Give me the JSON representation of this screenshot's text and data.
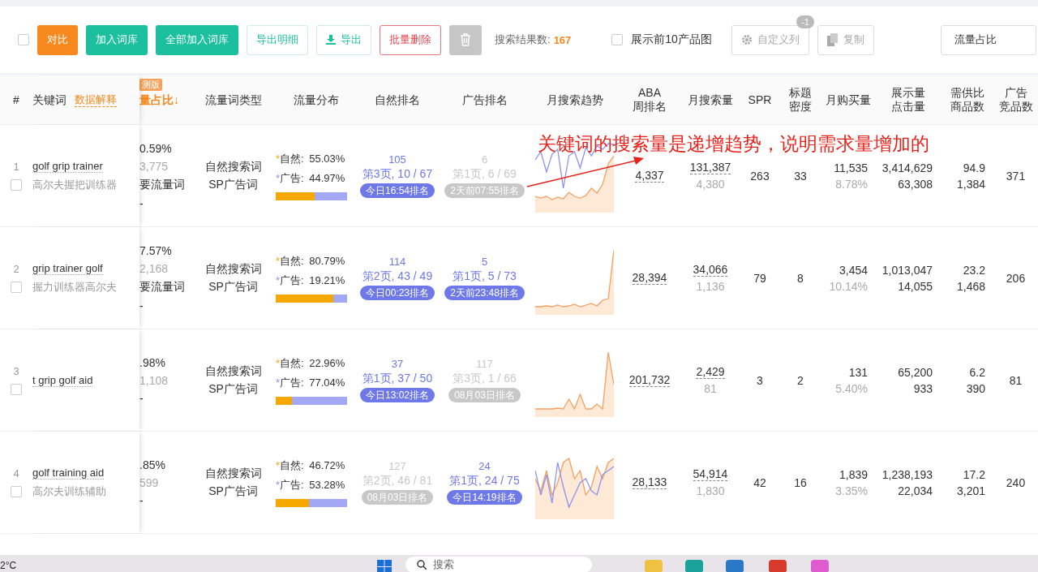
{
  "toolbar": {
    "checked": false,
    "buttons": [
      {
        "label": "对比",
        "kind": "orange"
      },
      {
        "label": "加入词库",
        "kind": "teal"
      },
      {
        "label": "全部加入词库",
        "kind": "teal"
      },
      {
        "label": "导出明细",
        "kind": "outline"
      },
      {
        "label": "导出",
        "kind": "download"
      },
      {
        "label": "批量删除",
        "kind": "danger"
      },
      {
        "kind": "trash"
      }
    ],
    "result_label": "搜索结果数:",
    "result_count": "167",
    "show_images": {
      "label": "展示前10产品图",
      "checked": false
    },
    "custom_columns": {
      "label": "自定义列",
      "badge": "-1"
    },
    "copy": {
      "label": "复制"
    },
    "sort_select": {
      "value": "流量占比"
    }
  },
  "table": {
    "columns": [
      {
        "lines": [
          "#"
        ]
      },
      {
        "lines": [
          "关键词"
        ],
        "help": "数据解释"
      },
      {
        "lines": [
          "量占比↓"
        ],
        "badge": "测版"
      },
      {
        "lines": [
          "流量词类型"
        ]
      },
      {
        "lines": [
          "流量分布"
        ]
      },
      {
        "lines": [
          "自然排名"
        ]
      },
      {
        "lines": [
          "广告排名"
        ]
      },
      {
        "lines": [
          "月搜索趋势"
        ]
      },
      {
        "lines": [
          "ABA",
          "周排名"
        ]
      },
      {
        "lines": [
          "月搜索量"
        ]
      },
      {
        "lines": [
          "SPR"
        ]
      },
      {
        "lines": [
          "标题",
          "密度"
        ]
      },
      {
        "lines": [
          "月购买量"
        ]
      },
      {
        "lines": [
          "展示量",
          "点击量"
        ]
      },
      {
        "lines": [
          "需供比",
          "商品数"
        ]
      },
      {
        "lines": [
          "广告",
          "竞品数"
        ]
      }
    ],
    "rows": [
      {
        "index": "1",
        "checked": false,
        "keyword": "golf grip trainer",
        "translation": "高尔夫握把训练器",
        "share": [
          "0.59%",
          "3,775",
          "要流量词",
          "-"
        ],
        "types": [
          "自然搜索词",
          "SP广告词"
        ],
        "distribution": {
          "natural_mark": "*",
          "natural_label": "自然:",
          "natural_value": "55.03%",
          "ad_mark": "*",
          "ad_label": "广告:",
          "ad_value": "44.97%",
          "level": 0.5503
        },
        "natural_rank": {
          "number": "105",
          "page": "第3页, 10 / 67",
          "time": "今日16:54排名",
          "active": true
        },
        "ad_rank": {
          "number": "6",
          "page": "第1页, 6 / 69",
          "time": "2天前07:55排名",
          "active": false
        },
        "aba": "4,337",
        "search": [
          "131,387",
          "4,380"
        ],
        "spr": "263",
        "title_density": "33",
        "purchase": [
          "11,535",
          "8.78%"
        ],
        "impressions": [
          "3,414,629",
          "63,308"
        ],
        "supply": [
          "94.9",
          "1,384"
        ],
        "ad_competitors": "371"
      },
      {
        "index": "2",
        "checked": false,
        "keyword": "grip trainer golf",
        "translation": "握力训练器高尔夫",
        "share": [
          "7.57%",
          "2,168",
          "要流量词",
          "-"
        ],
        "types": [
          "自然搜索词",
          "SP广告词"
        ],
        "distribution": {
          "natural_mark": "*",
          "natural_label": "自然:",
          "natural_value": "80.79%",
          "ad_mark": "*",
          "ad_label": "广告:",
          "ad_value": "19.21%",
          "level": 0.8079
        },
        "natural_rank": {
          "number": "114",
          "page": "第2页, 43 / 49",
          "time": "今日00:23排名",
          "active": true
        },
        "ad_rank": {
          "number": "5",
          "page": "第1页, 5 / 73",
          "time": "2天前23:48排名",
          "active": true
        },
        "aba": "28,394",
        "search": [
          "34,066",
          "1,136"
        ],
        "spr": "79",
        "title_density": "8",
        "purchase": [
          "3,454",
          "10.14%"
        ],
        "impressions": [
          "1,013,047",
          "14,055"
        ],
        "supply": [
          "23.2",
          "1,468"
        ],
        "ad_competitors": "206"
      },
      {
        "index": "3",
        "checked": false,
        "keyword": "t grip golf aid",
        "share": [
          ".98%",
          "1,108",
          "-"
        ],
        "types": [
          "自然搜索词",
          "SP广告词"
        ],
        "distribution": {
          "natural_mark": "*",
          "natural_label": "自然:",
          "natural_value": "22.96%",
          "ad_mark": "*",
          "ad_label": "广告:",
          "ad_value": "77.04%",
          "level": 0.2296
        },
        "natural_rank": {
          "number": "37",
          "page": "第1页, 37 / 50",
          "time": "今日13:02排名",
          "active": true
        },
        "ad_rank": {
          "number": "117",
          "page": "第3页, 1 / 66",
          "time": "08月03日排名",
          "active": false
        },
        "aba": "201,732",
        "search": [
          "2,429",
          "81"
        ],
        "spr": "3",
        "title_density": "2",
        "purchase": [
          "131",
          "5.40%"
        ],
        "impressions": [
          "65,200",
          "933"
        ],
        "supply": [
          "6.2",
          "390"
        ],
        "ad_competitors": "81"
      },
      {
        "index": "4",
        "checked": false,
        "keyword": "golf training aid",
        "translation": "高尔夫训练辅助",
        "share": [
          ".85%",
          "599",
          "-"
        ],
        "types": [
          "自然搜索词",
          "SP广告词"
        ],
        "distribution": {
          "natural_mark": "*",
          "natural_label": "自然:",
          "natural_value": "46.72%",
          "ad_mark": "*",
          "ad_label": "广告:",
          "ad_value": "53.28%",
          "level": 0.4672
        },
        "natural_rank": {
          "number": "127",
          "page": "第2页, 46 / 81",
          "time": "08月03日排名",
          "active": false
        },
        "ad_rank": {
          "number": "24",
          "page": "第1页, 24 / 75",
          "time": "今日14:19排名",
          "active": true
        },
        "aba": "28,133",
        "search": [
          "54,914",
          "1,830"
        ],
        "spr": "42",
        "title_density": "16",
        "purchase": [
          "1,839",
          "3.35%"
        ],
        "impressions": [
          "1,238,193",
          "22,034"
        ],
        "supply": [
          "17.2",
          "3,201"
        ],
        "ad_competitors": "240"
      }
    ]
  },
  "annotation": {
    "text": "关键词的搜索量是递增趋势，说明需求量增加的"
  },
  "taskbar": {
    "weather": "2°C",
    "search_placeholder": "搜索"
  }
}
